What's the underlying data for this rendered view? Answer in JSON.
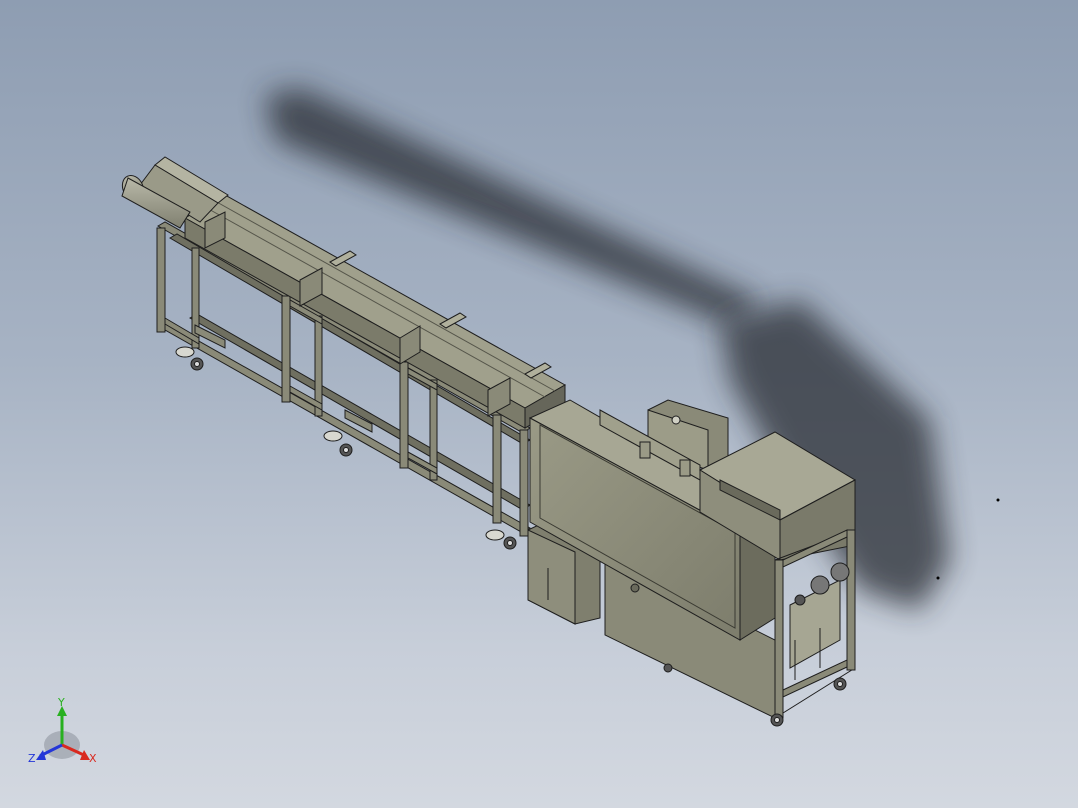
{
  "viewport": {
    "background_top": "#8e9db2",
    "background_bottom": "#d3d8e0"
  },
  "model": {
    "body_color": "#8a8a78",
    "body_dark": "#5f5f52",
    "body_light": "#a3a390",
    "outline_color": "#1e1e1e",
    "shadow_color": "#2b2f36"
  },
  "triad": {
    "x_label": "X",
    "y_label": "Y",
    "z_label": "Z",
    "x_color": "#d9291f",
    "y_color": "#28b020",
    "z_color": "#2436d8"
  },
  "marks": {
    "dot_color": "#000000"
  }
}
